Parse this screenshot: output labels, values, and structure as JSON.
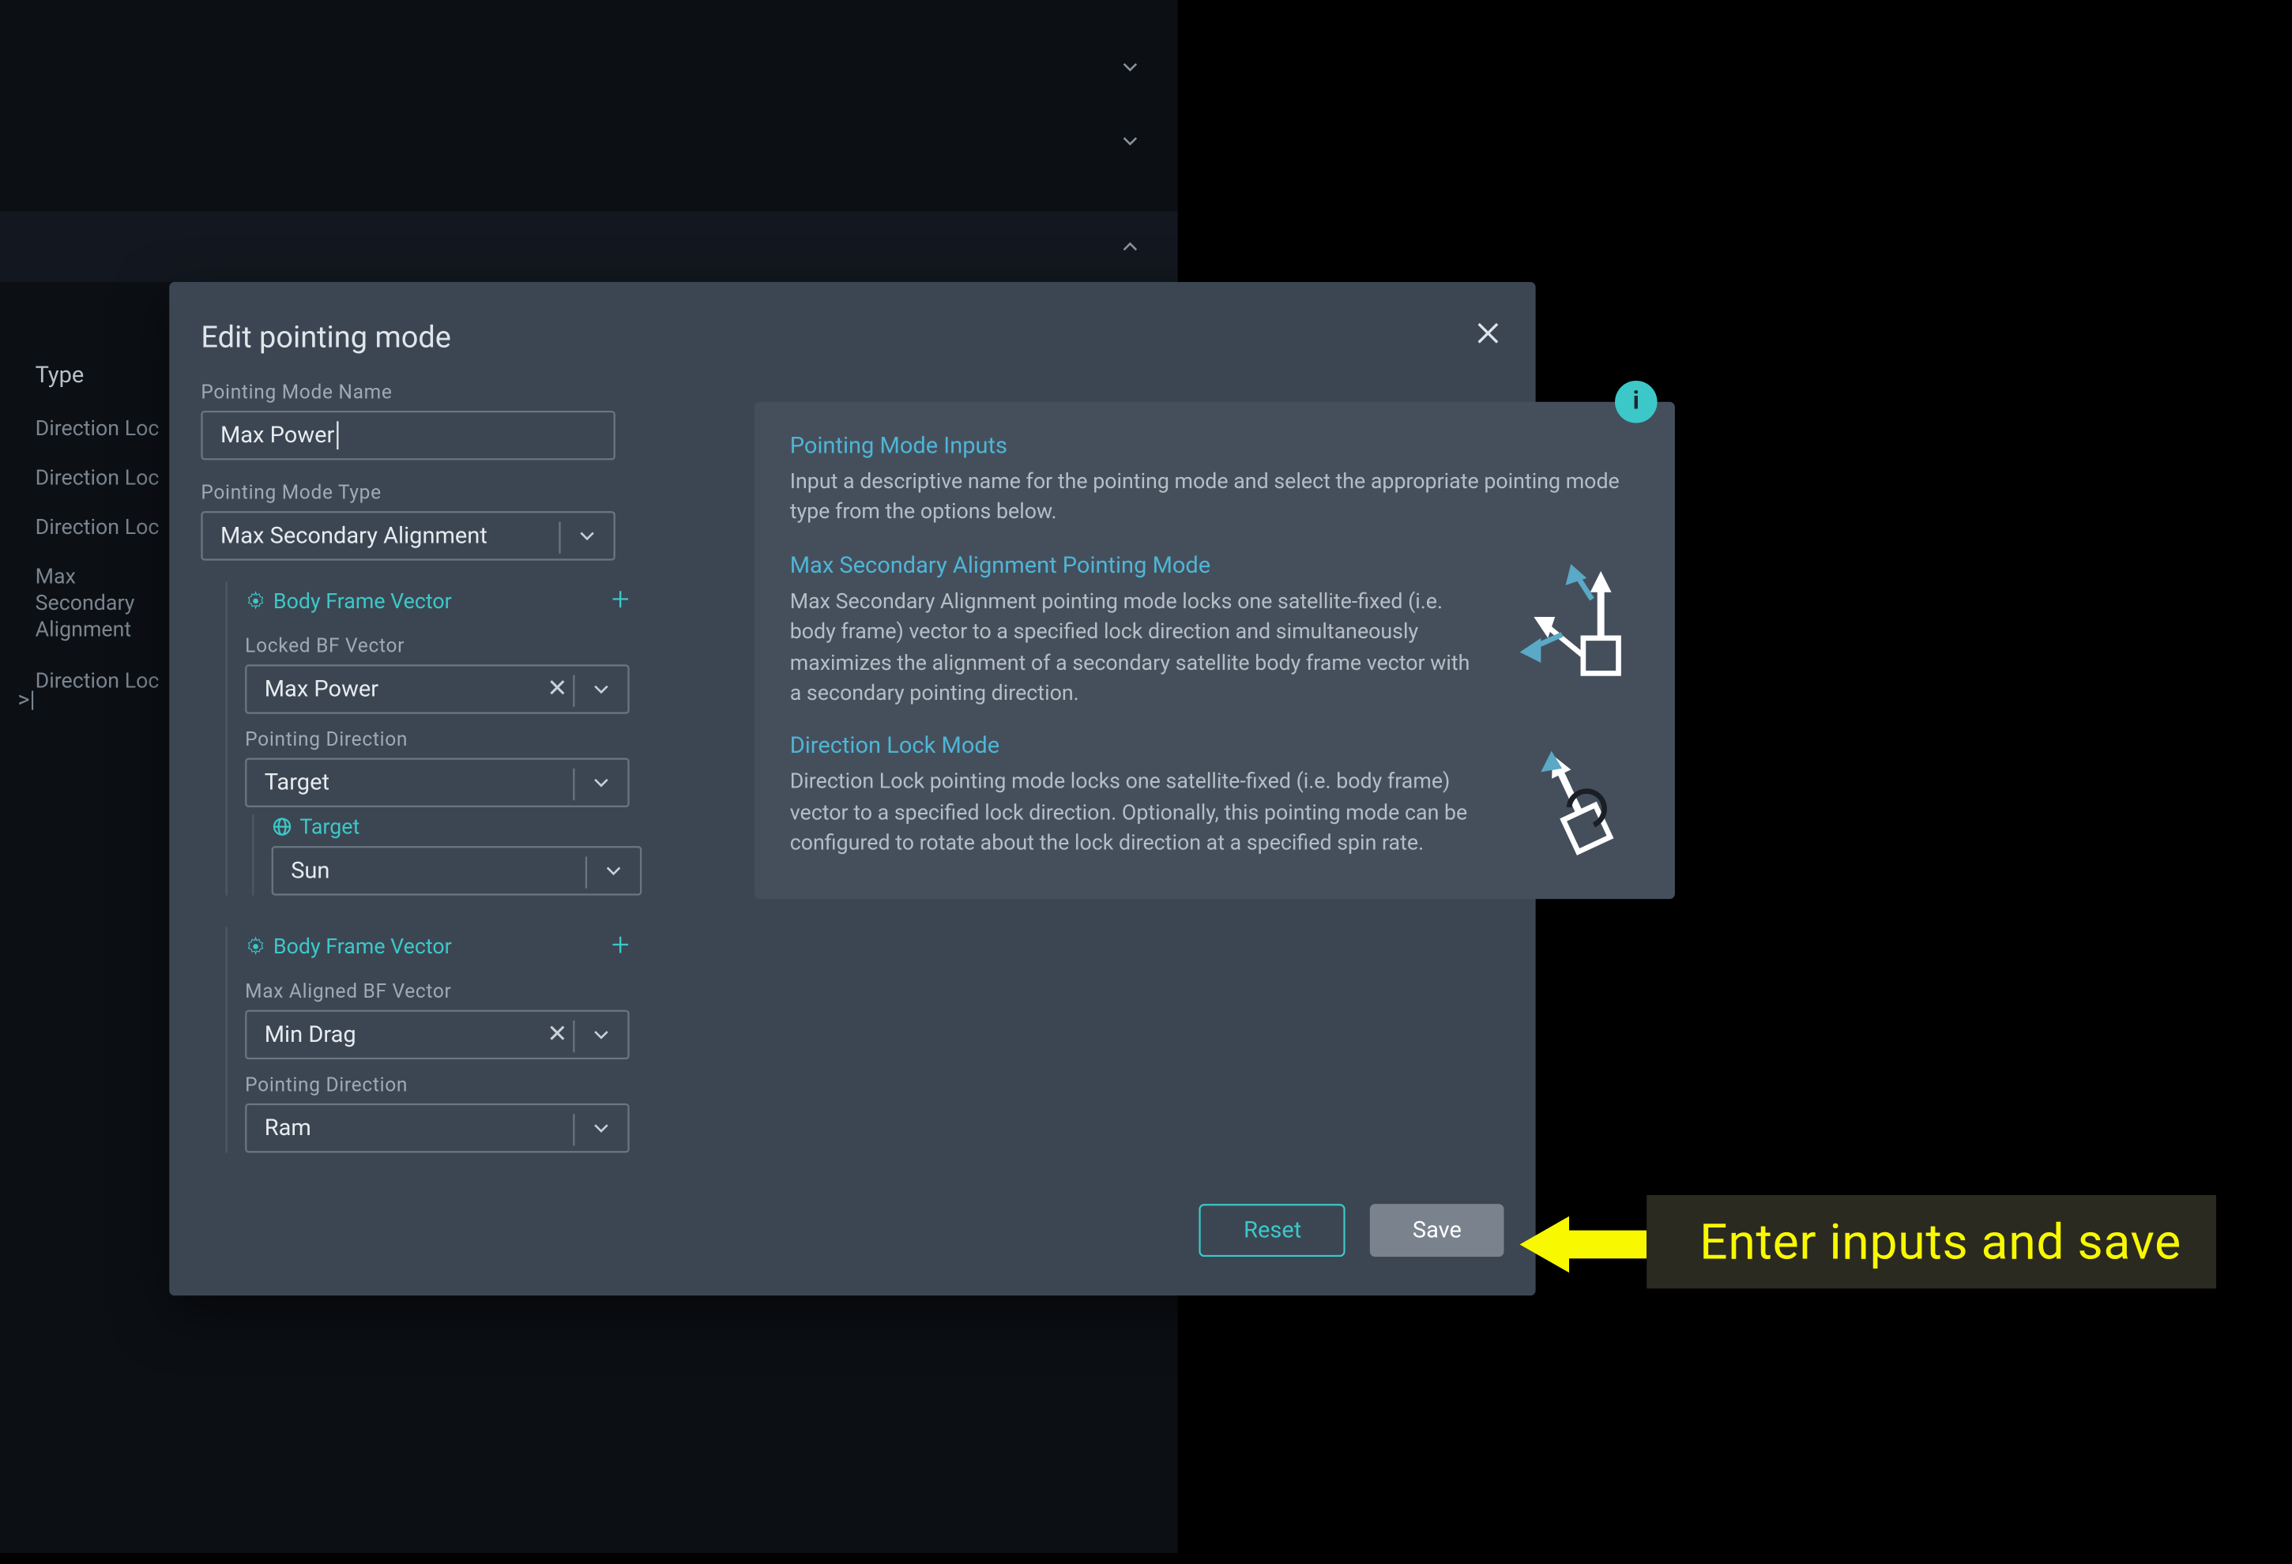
{
  "sidebar": {
    "header": "Type",
    "items": [
      "Direction Loc",
      "Direction Loc",
      "Direction Loc",
      "Max Secondary Alignment",
      "Direction Loc"
    ],
    "pager": ">|"
  },
  "modal": {
    "title": "Edit pointing mode",
    "name_label": "Pointing Mode Name",
    "name_value": "Max Power",
    "type_label": "Pointing Mode Type",
    "type_value": "Max Secondary Alignment",
    "bfv1": {
      "header": "Body Frame Vector",
      "locked_label": "Locked BF Vector",
      "locked_value": "Max Power",
      "pd_label": "Pointing Direction",
      "pd_value": "Target",
      "target_header": "Target",
      "target_value": "Sun"
    },
    "bfv2": {
      "header": "Body Frame Vector",
      "max_label": "Max Aligned BF Vector",
      "max_value": "Min Drag",
      "pd_label": "Pointing Direction",
      "pd_value": "Ram"
    },
    "reset_label": "Reset",
    "save_label": "Save"
  },
  "info": {
    "h1": "Pointing Mode Inputs",
    "p1": "Input a descriptive name for the pointing mode and select the appropriate pointing mode type from the options below.",
    "h2": "Max Secondary Alignment Pointing Mode",
    "p2": "Max Secondary Alignment pointing mode locks one satellite-fixed (i.e. body frame) vector to a specified lock direction and simultaneously maximizes the alignment of a secondary satellite body frame vector with a secondary pointing direction.",
    "h3": "Direction Lock Mode",
    "p3": "Direction Lock pointing mode locks one satellite-fixed (i.e. body frame) vector to a specified lock direction. Optionally, this pointing mode can be configured to rotate about the lock direction at a specified spin rate."
  },
  "annotation": "Enter inputs and save"
}
